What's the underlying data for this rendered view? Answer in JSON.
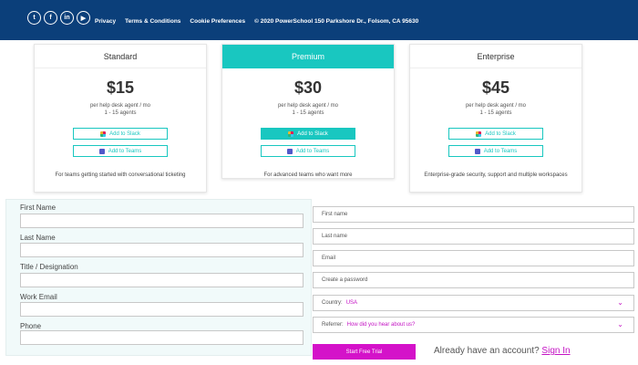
{
  "header": {
    "social_icons": [
      "twitter-icon",
      "facebook-icon",
      "linkedin-icon",
      "youtube-icon"
    ],
    "social_glyphs": [
      "t",
      "f",
      "in",
      "▶"
    ],
    "links": [
      "Privacy",
      "Terms & Conditions",
      "Cookie Preferences"
    ],
    "copyright": "© 2020 PowerSchool 150 Parkshore Dr., Folsom, CA 95630"
  },
  "plans": [
    {
      "name": "Standard",
      "price": "$15",
      "per": "per help desk agent / mo",
      "agents": "1 - 15 agents",
      "slack": "Add to Slack",
      "teams": "Add to Teams",
      "desc": "For teams getting started with conversational ticketing"
    },
    {
      "name": "Premium",
      "price": "$30",
      "per": "per help desk agent / mo",
      "agents": "1 - 15 agents",
      "slack": "Add to Slack",
      "teams": "Add to Teams",
      "desc": "For advanced teams who want more"
    },
    {
      "name": "Enterprise",
      "price": "$45",
      "per": "per help desk agent / mo",
      "agents": "1 - 15 agents",
      "slack": "Add to Slack",
      "teams": "Add to Teams",
      "desc": "Enterprise-grade security, support and multiple workspaces"
    }
  ],
  "left_form": {
    "first_name_label": "First Name",
    "last_name_label": "Last Name",
    "title_label": "Title / Designation",
    "work_email_label": "Work Email",
    "phone_label": "Phone"
  },
  "right_form": {
    "first_name_placeholder": "First name",
    "last_name_placeholder": "Last name",
    "email_placeholder": "Email",
    "password_placeholder": "Create a password",
    "country_label": "Country:",
    "country_value": "USA",
    "referrer_label": "Referrer:",
    "referrer_value": "How did you hear about us?",
    "submit_label": "Start Free Trial",
    "already_text": "Already have an account?",
    "signin_label": "Sign In"
  },
  "colors": {
    "header_bg": "#0b3f7a",
    "accent_teal": "#19c7c0",
    "accent_magenta": "#d412c9"
  }
}
